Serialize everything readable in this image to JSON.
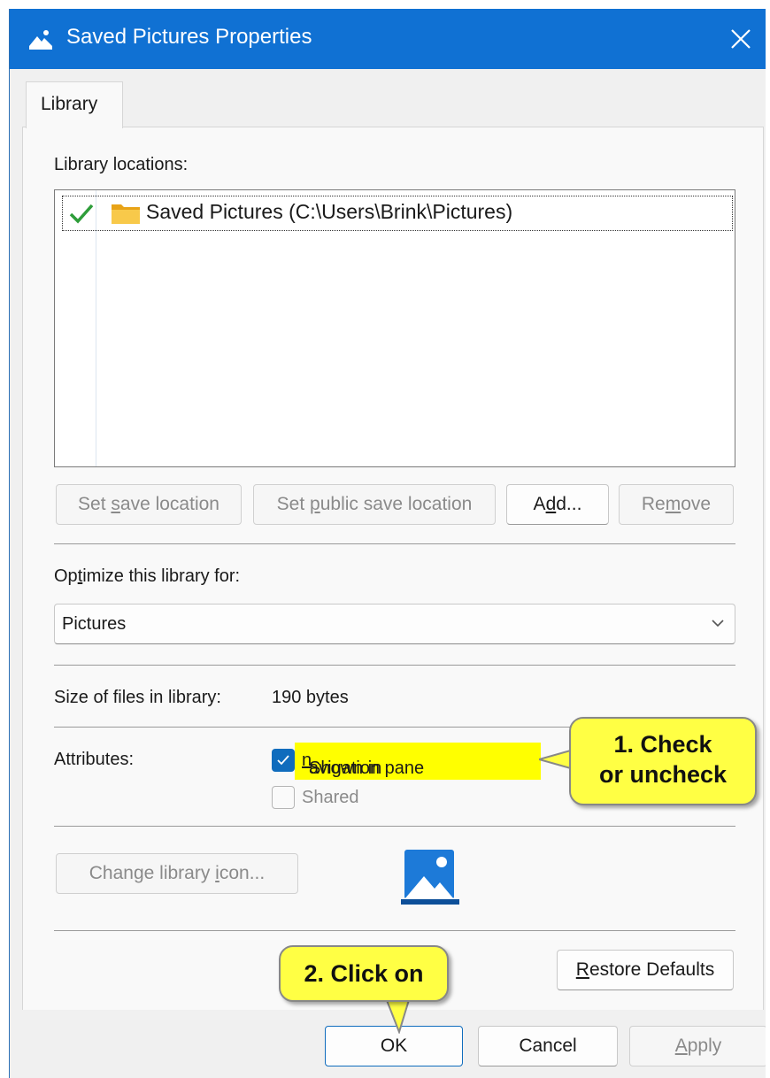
{
  "window": {
    "title": "Saved Pictures Properties",
    "accent": "#1071d3"
  },
  "tabs": [
    {
      "label": "Library",
      "selected": true
    }
  ],
  "locations": {
    "label": "Library locations:",
    "items": [
      {
        "text": "Saved Pictures (C:\\Users\\Brink\\Pictures)",
        "default": true
      }
    ]
  },
  "location_buttons": {
    "set_save": {
      "pre": "Set ",
      "key": "s",
      "post": "ave location"
    },
    "set_public": {
      "pre": "Set ",
      "key": "p",
      "post": "ublic save location"
    },
    "add": {
      "pre": "A",
      "key": "d",
      "post": "d..."
    },
    "remove": {
      "pre": "Re",
      "key": "m",
      "post": "ove"
    }
  },
  "optimize": {
    "label_pre": "Op",
    "label_key": "t",
    "label_post": "imize this library for:",
    "selected": "Pictures"
  },
  "size": {
    "label": "Size of files in library:",
    "value": "190 bytes"
  },
  "attributes": {
    "label": "Attributes:",
    "shown": {
      "pre": "Shown in ",
      "key": "n",
      "post": "avigation pane",
      "checked": true
    },
    "shared": {
      "label": "Shared",
      "checked": false
    }
  },
  "icon_button": {
    "pre": "Change library ",
    "key": "i",
    "post": "con..."
  },
  "restore_button": {
    "key": "R",
    "post": "estore Defaults"
  },
  "footer": {
    "ok": "OK",
    "cancel": "Cancel",
    "apply": {
      "key": "A",
      "post": "pply"
    }
  },
  "callouts": {
    "step1_line1": "1. Check",
    "step1_line2": "or uncheck",
    "step2": "2. Click on",
    "color": "#ffff44"
  }
}
